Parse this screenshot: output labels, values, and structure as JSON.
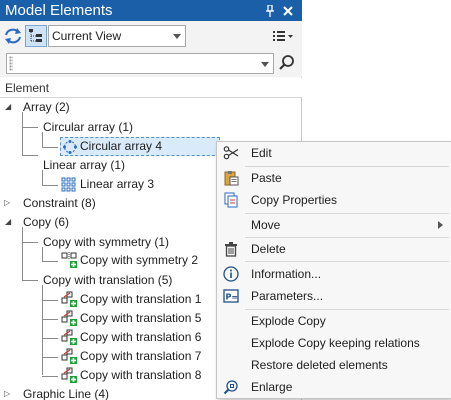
{
  "panel": {
    "title": "Model Elements",
    "pin_glyph": "📌",
    "close_glyph": "✕"
  },
  "toolbar": {
    "sync_icon": "refresh-arrows-icon",
    "tree_icon": "tree-view-icon",
    "view_value": "Current View",
    "list_menu_icon": "list-menu-icon"
  },
  "search": {
    "value": "",
    "search_icon": "magnifier-icon"
  },
  "columns": {
    "element": "Element"
  },
  "tree": {
    "array": "Array (2)",
    "circular_array_group": "Circular array (1)",
    "circular_array_4": "Circular array 4",
    "linear_array_group": "Linear array (1)",
    "linear_array_3": "Linear array 3",
    "constraint": "Constraint (8)",
    "copy": "Copy (6)",
    "copy_sym_group": "Copy with symmetry (1)",
    "copy_sym_2": "Copy with symmetry 2",
    "copy_trans_group": "Copy with translation (5)",
    "copy_trans_items": [
      "Copy with translation 1",
      "Copy with translation 5",
      "Copy with translation 6",
      "Copy with translation 7",
      "Copy with translation 8"
    ],
    "graphic_line": "Graphic Line (4)"
  },
  "context_menu": {
    "edit": "Edit",
    "paste": "Paste",
    "copy_properties": "Copy Properties",
    "move": "Move",
    "delete": "Delete",
    "information": "Information...",
    "parameters": "Parameters...",
    "explode_copy": "Explode Copy",
    "explode_copy_keep": "Explode Copy keeping relations",
    "restore_deleted": "Restore deleted elements",
    "enlarge": "Enlarge"
  },
  "colors": {
    "title_bar": "#1a5fa8",
    "selection": "#d9ebfb",
    "menu_bg": "#f7f7f7"
  }
}
